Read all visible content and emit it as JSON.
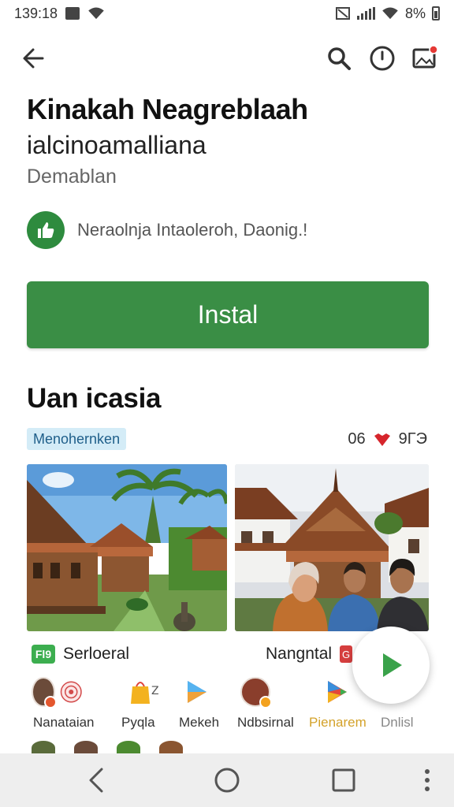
{
  "status_bar": {
    "time": "139:18",
    "battery": "8%",
    "icons": [
      "gallery-icon",
      "wifi-icon",
      "nfc-icon",
      "signal-icon",
      "wifi-icon",
      "battery-icon"
    ]
  },
  "top_bar": {
    "icons": [
      "back-arrow-icon",
      "search-icon",
      "clock-icon",
      "notification-image-icon"
    ],
    "notification_color": "#e53935"
  },
  "app": {
    "title": "Kinakah Neagreblaah",
    "subtitle": "ialcinoamalliana",
    "developer": "Demablan",
    "recommendation": "Neraolnja Intaoleroh, Daonig.!"
  },
  "install_button": {
    "label": "Instal",
    "color": "#3a8e45"
  },
  "section": {
    "title": "Uan icasia",
    "tag": "Menohernken",
    "rating_count": "06",
    "rating_value": "9ГЭ"
  },
  "screenshots": [
    {
      "name": "village-houses-palms-image"
    },
    {
      "name": "people-front-of-house-image"
    }
  ],
  "app_rows": [
    {
      "badge": "Fl9",
      "label": "Serloeral"
    },
    {
      "badge": "G",
      "label": "Nangntal"
    }
  ],
  "apps": [
    {
      "label": "Nanataian",
      "icon": "avatar-icon"
    },
    {
      "label": "Pyqla",
      "icon": "seal-icon"
    },
    {
      "label": "Mekeh",
      "icon": "bag-icon"
    },
    {
      "label": "Ndbsirnal",
      "icon": "play-triangle-icon"
    },
    {
      "label": "Pienarem",
      "icon": "avatar-icon",
      "color": "#d4a22a"
    },
    {
      "label": "Dnlisl",
      "icon": "play-store-icon"
    }
  ],
  "fab_icon": "play-icon",
  "nav_bar": {
    "icons": [
      "back-icon",
      "home-icon",
      "recents-icon",
      "more-vertical-icon"
    ]
  }
}
